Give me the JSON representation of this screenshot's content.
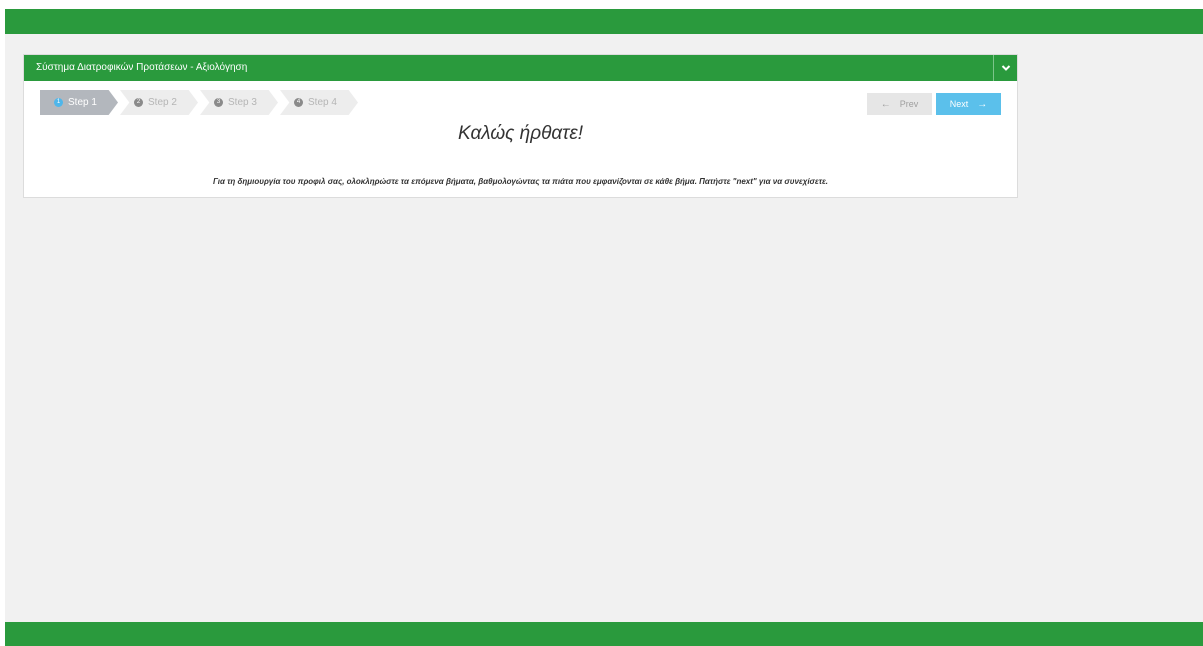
{
  "header": {
    "title": "Σύστημα Διατροφικών Προτάσεων - Αξιολόγηση",
    "collapse_icon": "chevron-down-icon"
  },
  "wizard": {
    "steps": [
      {
        "number": "1",
        "label": "Step 1",
        "active": true
      },
      {
        "number": "2",
        "label": "Step 2",
        "active": false
      },
      {
        "number": "3",
        "label": "Step 3",
        "active": false
      },
      {
        "number": "4",
        "label": "Step 4",
        "active": false
      }
    ],
    "prev_label": "Prev",
    "next_label": "Next",
    "prev_icon": "arrow-left-icon",
    "next_icon": "arrow-right-icon"
  },
  "content": {
    "welcome": "Καλώς ήρθατε!",
    "instructions": "Για τη δημιουργία του προφιλ σας, ολοκληρώστε τα επόμενα βήματα, βαθμολογώντας τα πιάτα που εμφανίζονται σε κάθε βήμα. Πατήστε \"next\" για να συνεχίσετε."
  },
  "colors": {
    "brand_green": "#2a9a3d",
    "active_step": "#b3b7bd",
    "next_button": "#5bc0eb",
    "prev_button": "#e6e6e6",
    "background": "#f1f1f1"
  }
}
